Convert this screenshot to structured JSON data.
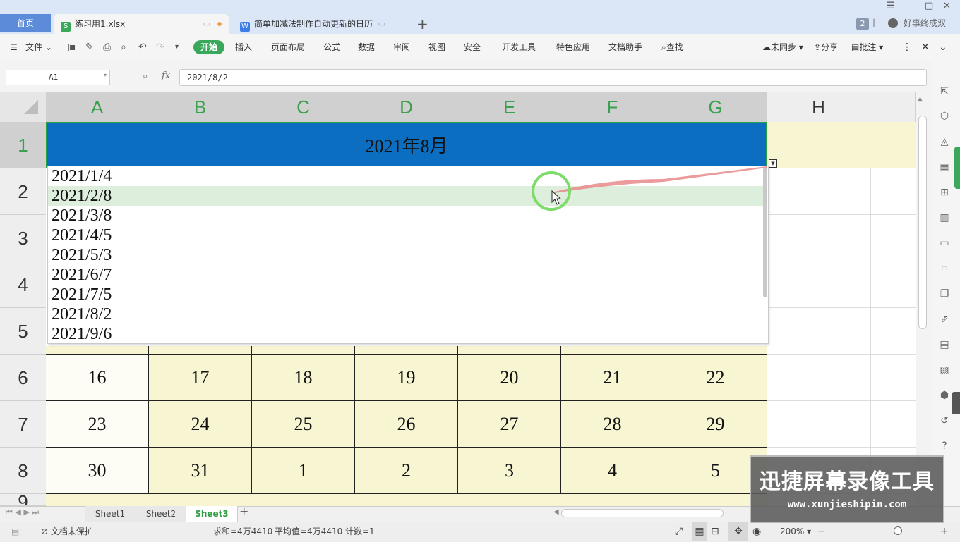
{
  "tabbar": {
    "home_label": "首页",
    "active_tab": {
      "icon_letter": "S",
      "icon_color": "#3aa85a",
      "label": "练习用1.xlsx"
    },
    "other_tab": {
      "icon_letter": "W",
      "icon_color": "#3b7ee8",
      "label": "简单加减法制作自动更新的日历"
    },
    "badge_count": "2",
    "user_name": "好事终成双"
  },
  "menu": {
    "file_label": "文件",
    "start_label": "开始",
    "items": [
      "插入",
      "页面布局",
      "公式",
      "数据",
      "审阅",
      "视图",
      "安全",
      "开发工具",
      "特色应用",
      "文档助手"
    ],
    "search_label": "查找",
    "sync_label": "未同步",
    "share_label": "分享",
    "comment_label": "批注"
  },
  "formula_bar": {
    "cell_ref": "A1",
    "fx_label": "fx",
    "value": "2021/8/2"
  },
  "grid": {
    "columns": [
      "A",
      "B",
      "C",
      "D",
      "E",
      "F",
      "G",
      "H"
    ],
    "rows": [
      "1",
      "2",
      "3",
      "4",
      "5",
      "6",
      "7",
      "8",
      "9"
    ],
    "title": "2021年8月",
    "week_rows": [
      [
        "16",
        "17",
        "18",
        "19",
        "20",
        "21",
        "22"
      ],
      [
        "23",
        "24",
        "25",
        "26",
        "27",
        "28",
        "29"
      ],
      [
        "30",
        "31",
        "1",
        "2",
        "3",
        "4",
        "5"
      ]
    ]
  },
  "dropdown": {
    "options": [
      "2021/1/4",
      "2021/2/8",
      "2021/3/8",
      "2021/4/5",
      "2021/5/3",
      "2021/6/7",
      "2021/7/5",
      "2021/8/2",
      "2021/9/6"
    ],
    "hovered_index": 1
  },
  "sheets": {
    "tabs": [
      "Sheet1",
      "Sheet2",
      "Sheet3"
    ],
    "active": "Sheet3",
    "add_label": "+"
  },
  "status": {
    "protect_label": "文档未保护",
    "sum": "求和=4万4410",
    "avg": "平均值=4万4410",
    "count": "计数=1",
    "zoom": "200%"
  },
  "watermark": {
    "title": "迅捷屏幕录像工具",
    "url": "www.xunjieshipin.com"
  },
  "colors": {
    "title_fill": "#0b6ec1",
    "accent_green": "#3aa85a",
    "cell_yellow": "#f7f5d2"
  }
}
